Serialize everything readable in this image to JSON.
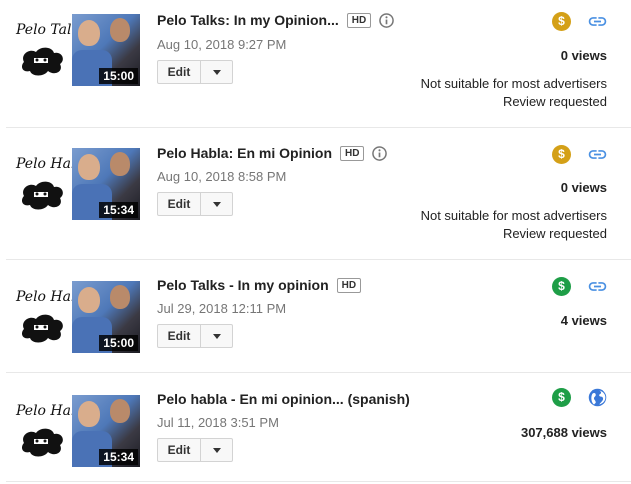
{
  "colors": {
    "monetization_limited": "#d4a017",
    "monetization_on": "#1e9e47",
    "link_icon": "#4a90e2",
    "globe_icon": "#3a78d8"
  },
  "videos": [
    {
      "title": "Pelo Talks: In my Opinion...",
      "hd": "HD",
      "has_info_icon": true,
      "date": "Aug 10, 2018 9:27 PM",
      "duration": "15:00",
      "thumb_logo": "Pelo Talks",
      "edit_label": "Edit",
      "monetization_icon": "dollar-icon",
      "monetization_status": "limited",
      "visibility_icon": "link-icon",
      "views": "0 views",
      "note_line1": "Not suitable for most advertisers",
      "note_line2": "Review requested"
    },
    {
      "title": "Pelo Habla: En mi Opinion",
      "hd": "HD",
      "has_info_icon": true,
      "date": "Aug 10, 2018 8:58 PM",
      "duration": "15:34",
      "thumb_logo": "Pelo Habla",
      "edit_label": "Edit",
      "monetization_icon": "dollar-icon",
      "monetization_status": "limited",
      "visibility_icon": "link-icon",
      "views": "0 views",
      "note_line1": "Not suitable for most advertisers",
      "note_line2": "Review requested"
    },
    {
      "title": "Pelo Talks - In my opinion",
      "hd": "HD",
      "has_info_icon": false,
      "date": "Jul 29, 2018 12:11 PM",
      "duration": "15:00",
      "thumb_logo": "Pelo Habla",
      "edit_label": "Edit",
      "monetization_icon": "dollar-icon",
      "monetization_status": "on",
      "visibility_icon": "link-icon",
      "views": "4 views"
    },
    {
      "title": "Pelo habla - En mi opinion... (spanish)",
      "date": "Jul 11, 2018 3:51 PM",
      "duration": "15:34",
      "thumb_logo": "Pelo Habla",
      "edit_label": "Edit",
      "monetization_icon": "dollar-icon",
      "monetization_status": "on",
      "visibility_icon": "globe-icon",
      "views": "307,688 views"
    }
  ]
}
